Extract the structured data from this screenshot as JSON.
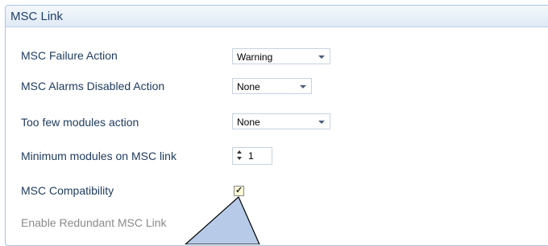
{
  "panel": {
    "title": "MSC Link"
  },
  "fields": {
    "failure_action": {
      "label": "MSC Failure Action",
      "value": "Warning"
    },
    "alarms_disabled_action": {
      "label": "MSC Alarms Disabled Action",
      "value": "None"
    },
    "too_few_modules_action": {
      "label": "Too few modules action",
      "value": "None"
    },
    "minimum_modules": {
      "label": "Minimum modules on MSC link",
      "value": "1"
    },
    "compatibility": {
      "label": "MSC Compatibility",
      "checked": true,
      "checkmark": "✓"
    },
    "redundant_link": {
      "label": "Enable Redundant MSC Link",
      "enabled": false
    }
  },
  "colors": {
    "panel_border": "#a8c4e0",
    "label_text": "#1e3a5f",
    "callout_fill": "#b7cbe8"
  }
}
